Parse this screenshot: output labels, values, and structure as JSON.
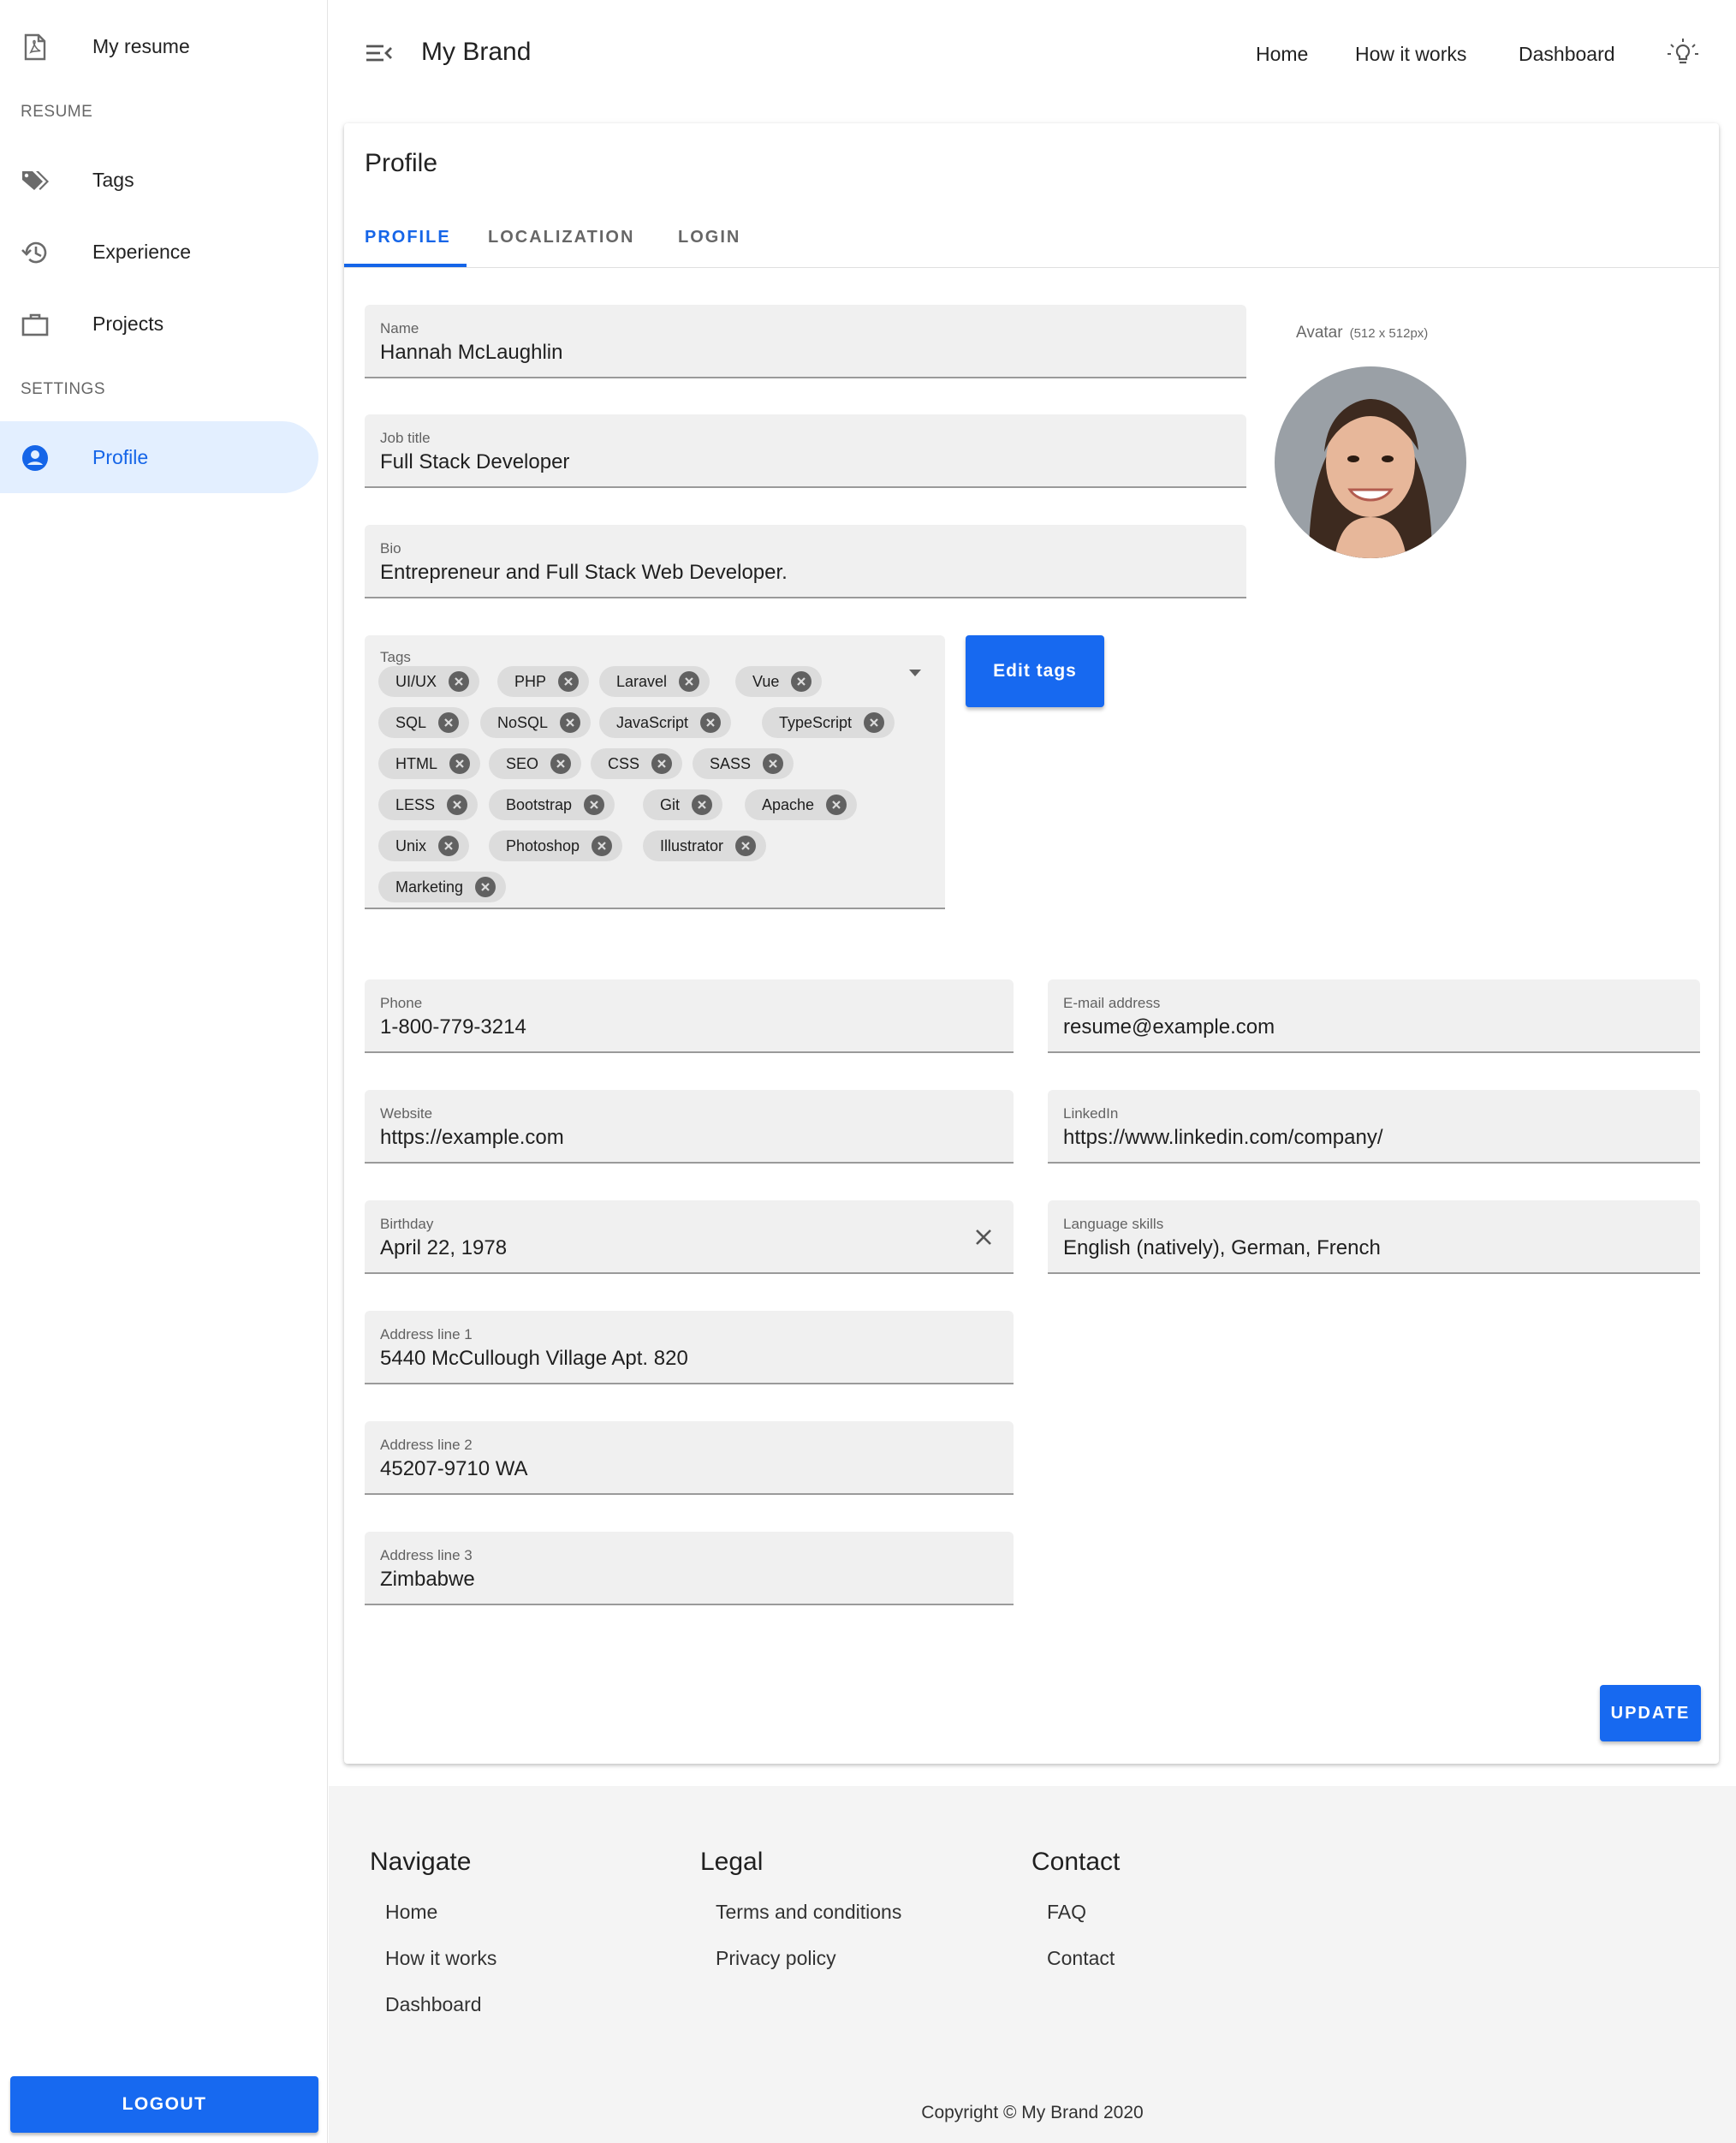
{
  "sidebar": {
    "my_resume": "My resume",
    "section_resume": "RESUME",
    "tags": "Tags",
    "experience": "Experience",
    "projects": "Projects",
    "section_settings": "SETTINGS",
    "profile": "Profile",
    "logout": "LOGOUT"
  },
  "topbar": {
    "brand": "My Brand",
    "nav": [
      "Home",
      "How it works",
      "Dashboard"
    ]
  },
  "card": {
    "title": "Profile",
    "tabs": [
      "PROFILE",
      "LOCALIZATION",
      "LOGIN"
    ],
    "active_tab": "PROFILE",
    "fields": {
      "name": {
        "label": "Name",
        "value": "Hannah McLaughlin"
      },
      "job_title": {
        "label": "Job title",
        "value": "Full Stack Developer"
      },
      "bio": {
        "label": "Bio",
        "value": "Entrepreneur and Full Stack Web Developer."
      },
      "phone": {
        "label": "Phone",
        "value": "1-800-779-3214"
      },
      "email": {
        "label": "E-mail address",
        "value": "resume@example.com"
      },
      "website": {
        "label": "Website",
        "value": "https://example.com"
      },
      "linkedin": {
        "label": "LinkedIn",
        "value": "https://www.linkedin.com/company/"
      },
      "birthday": {
        "label": "Birthday",
        "value": "April 22, 1978"
      },
      "language": {
        "label": "Language skills",
        "value": "English (natively), German, French"
      },
      "address1": {
        "label": "Address line 1",
        "value": "5440 McCullough Village Apt. 820"
      },
      "address2": {
        "label": "Address line 2",
        "value": "45207-9710 WA"
      },
      "address3": {
        "label": "Address line 3",
        "value": "Zimbabwe"
      }
    },
    "avatar": {
      "label": "Avatar",
      "dimensions": "(512 x 512px)"
    },
    "tags": {
      "label": "Tags",
      "items": [
        "UI/UX",
        "PHP",
        "Laravel",
        "Vue",
        "SQL",
        "NoSQL",
        "JavaScript",
        "TypeScript",
        "HTML",
        "SEO",
        "CSS",
        "SASS",
        "LESS",
        "Bootstrap",
        "Git",
        "Apache",
        "Unix",
        "Photoshop",
        "Illustrator",
        "Marketing"
      ]
    },
    "edit_tags": "Edit tags",
    "update": "UPDATE"
  },
  "footer": {
    "navigate": {
      "title": "Navigate",
      "links": [
        "Home",
        "How it works",
        "Dashboard"
      ]
    },
    "legal": {
      "title": "Legal",
      "links": [
        "Terms and conditions",
        "Privacy policy"
      ]
    },
    "contact": {
      "title": "Contact",
      "links": [
        "FAQ",
        "Contact"
      ]
    },
    "copyright": "Copyright © My Brand 2020"
  },
  "colors": {
    "primary": "#1769f0",
    "active_nav_bg": "#e3efff",
    "field_bg": "#f0f0f0",
    "footer_bg": "#f4f4f4"
  }
}
